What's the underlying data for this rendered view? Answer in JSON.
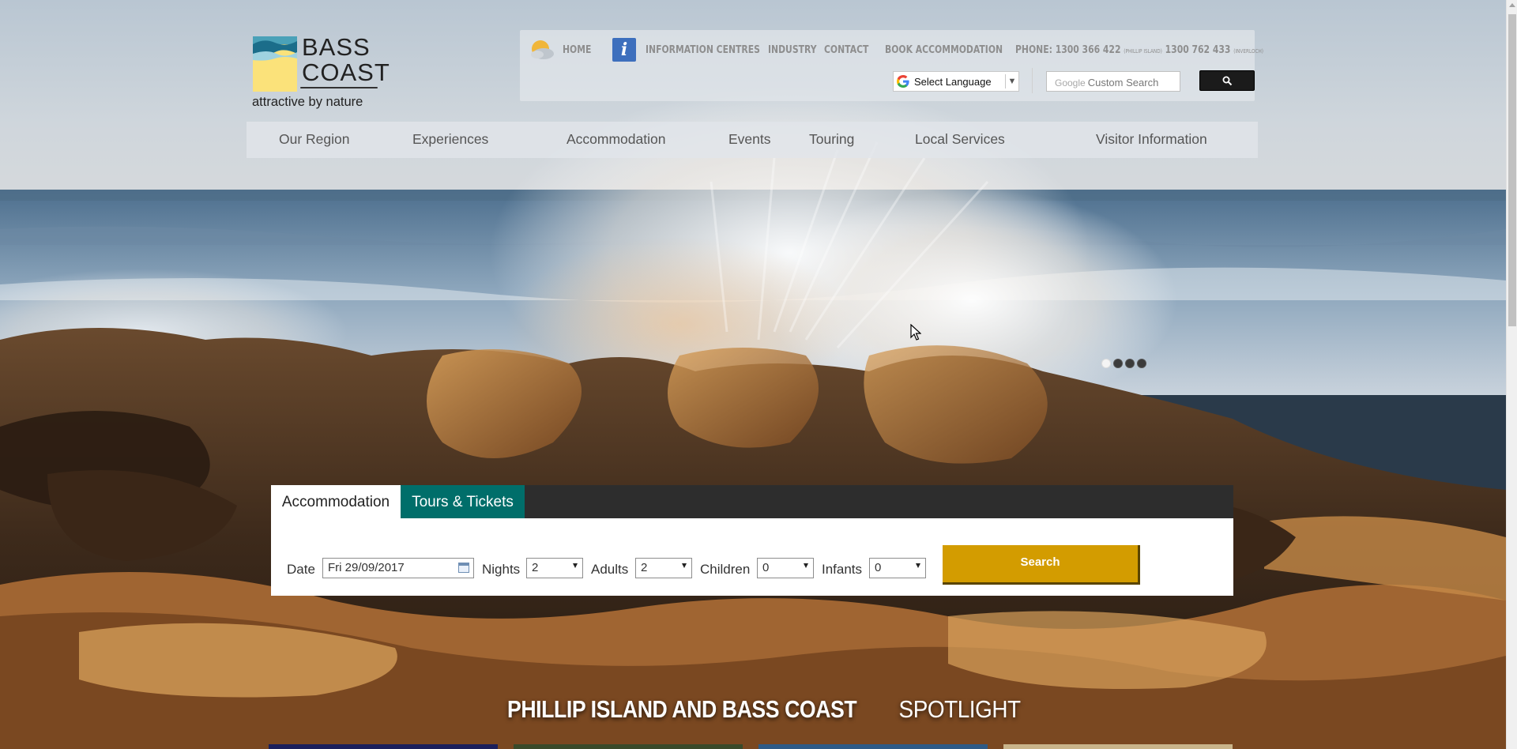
{
  "logo": {
    "word1": "BASS",
    "word2": "COAST",
    "tagline": "attractive by nature"
  },
  "utility": {
    "weather_icon": "sun-cloud-icon",
    "info_icon": "info-icon",
    "info_glyph": "i",
    "links": [
      "HOME",
      "INFORMATION CENTRES",
      "INDUSTRY",
      "CONTACT",
      "BOOK ACCOMMODATION"
    ],
    "phone_label": "PHONE:",
    "phone1": "1300 366 422",
    "phone1_note": "(PHILLIP ISLAND)",
    "phone2": "1300 762 433",
    "phone2_note": "(INVERLOCH)"
  },
  "translate": {
    "label": "Select Language",
    "caret": "▼"
  },
  "site_search": {
    "brand": "Google",
    "placeholder": "Custom Search"
  },
  "nav": {
    "items": [
      "Our Region",
      "Experiences",
      "Accommodation",
      "Events",
      "Touring",
      "Local Services",
      "Visitor Information"
    ]
  },
  "slider": {
    "slide_count": 4,
    "active_index": 0
  },
  "booking": {
    "tabs": [
      "Accommodation",
      "Tours & Tickets"
    ],
    "active_tab": "Accommodation",
    "date_label": "Date",
    "date_value": "Fri 29/09/2017",
    "nights_label": "Nights",
    "nights_value": "2",
    "adults_label": "Adults",
    "adults_value": "2",
    "children_label": "Children",
    "children_value": "0",
    "infants_label": "Infants",
    "infants_value": "0",
    "search_label": "Search"
  },
  "spotlight": {
    "bold": "PHILLIP ISLAND AND BASS COAST",
    "light": "SPOTLIGHT"
  },
  "colors": {
    "tab_teal": "#006e6a",
    "search_gold": "#d39c00",
    "tabbar_dark": "#2d2d2d",
    "info_blue": "#3d6fbd"
  }
}
